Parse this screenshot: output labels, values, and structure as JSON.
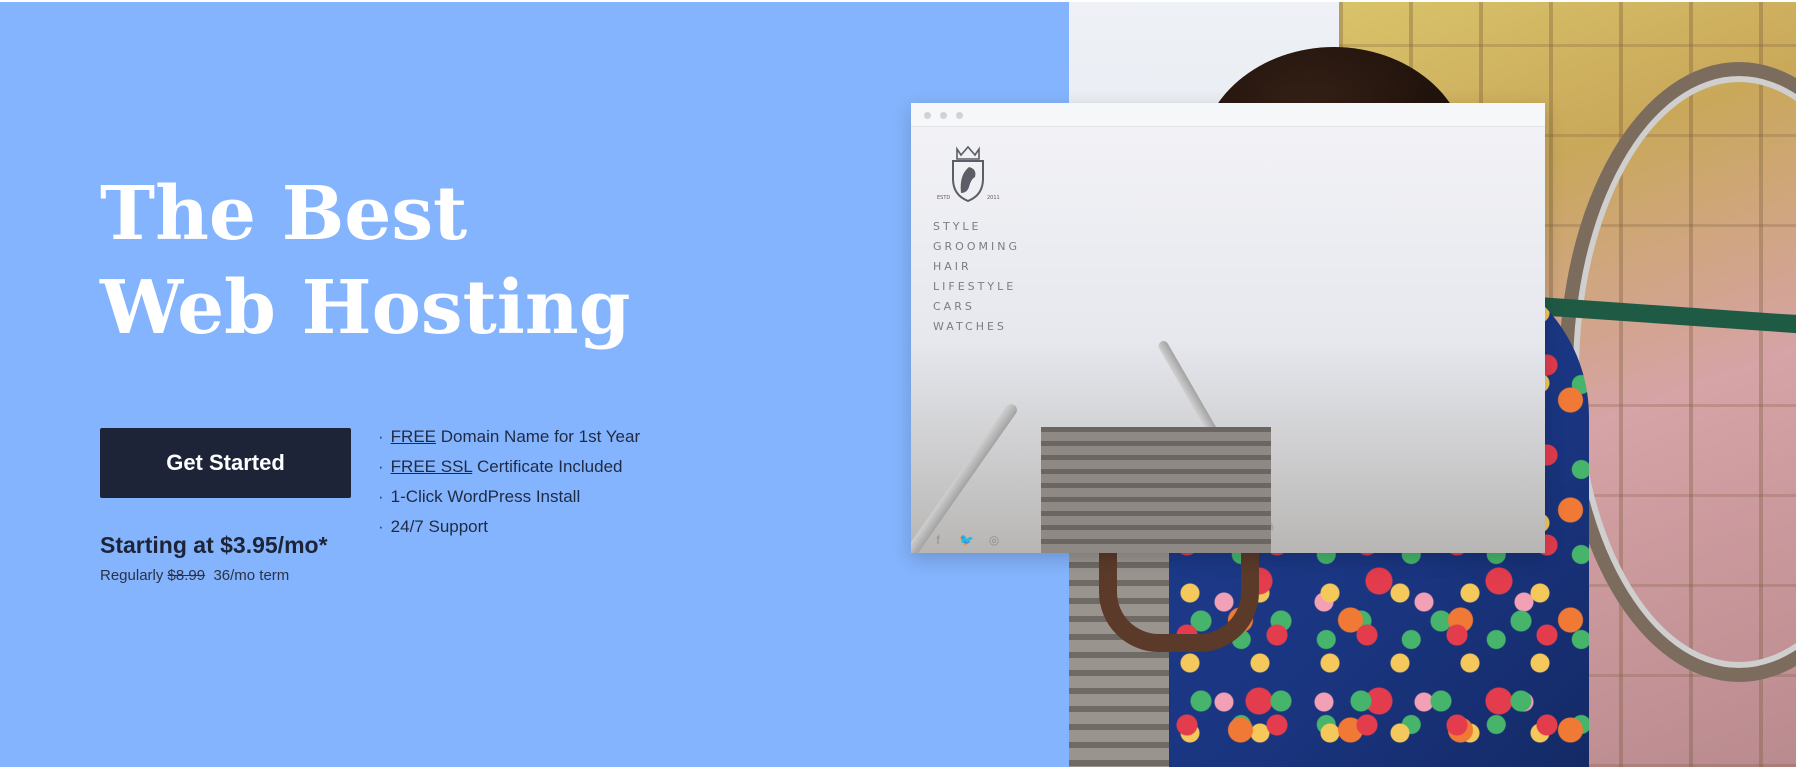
{
  "hero": {
    "headline_line1": "The Best",
    "headline_line2": "Web Hosting",
    "cta_label": "Get Started",
    "price": "Starting at $3.95/mo*",
    "regular_prefix": "Regularly",
    "regular_price": "$8.99",
    "term": "36/mo term",
    "features": [
      {
        "bullet": "·",
        "underlined": "FREE",
        "rest": " Domain Name for 1st Year"
      },
      {
        "bullet": "·",
        "underlined": "FREE SSL",
        "rest": " Certificate Included"
      },
      {
        "bullet": "·",
        "underlined": "",
        "rest": "1-Click WordPress Install"
      },
      {
        "bullet": "·",
        "underlined": "",
        "rest": "24/7 Support"
      }
    ]
  },
  "mockup": {
    "crest_left": "ESTD",
    "crest_right": "2011",
    "nav": [
      "STYLE",
      "GROOMING",
      "HAIR",
      "LIFESTYLE",
      "CARS",
      "WATCHES"
    ],
    "social_icons": [
      "facebook-icon",
      "twitter-icon",
      "instagram-icon"
    ],
    "social_glyphs": [
      "f",
      "🐦",
      "◎"
    ]
  },
  "colors": {
    "hero_bg": "#84b4fd",
    "button_bg": "#1d2438",
    "headline": "#ffffff"
  }
}
